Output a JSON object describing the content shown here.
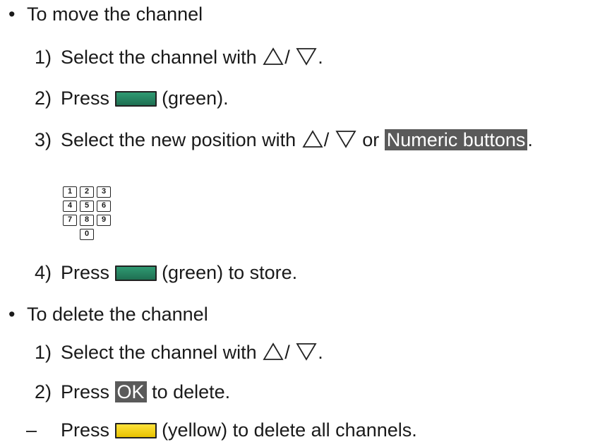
{
  "sections": [
    {
      "title": "To move the channel",
      "steps": {
        "s1": {
          "num": "1)",
          "text": "Select the channel with",
          "slash": "/",
          "end": "."
        },
        "s2": {
          "num": "2)",
          "pre": "Press",
          "post": "(green)."
        },
        "s3": {
          "num": "3)",
          "text": "Select the new position with",
          "slash": "/",
          "mid": "or",
          "highlight": "Numeric buttons",
          "end": "."
        },
        "s4": {
          "num": "4)",
          "pre": "Press",
          "post": "(green) to store."
        }
      }
    },
    {
      "title": "To delete the channel",
      "steps": {
        "s1": {
          "num": "1)",
          "text": "Select the channel with",
          "slash": "/",
          "end": "."
        },
        "s2": {
          "num": "2)",
          "pre": "Press",
          "highlight": "OK",
          "post": "to delete."
        },
        "s3": {
          "dash": "–",
          "pre": "Press",
          "post": "(yellow) to delete all channels."
        }
      }
    }
  ],
  "keypad": [
    "1",
    "2",
    "3",
    "4",
    "5",
    "6",
    "7",
    "8",
    "9",
    "0"
  ],
  "icons": {
    "up": "triangle-up-icon",
    "down": "triangle-down-icon"
  },
  "colors": {
    "green_button": "#2f9a72",
    "yellow_button": "#f2d000",
    "highlight_bg": "#5a5a5a"
  }
}
